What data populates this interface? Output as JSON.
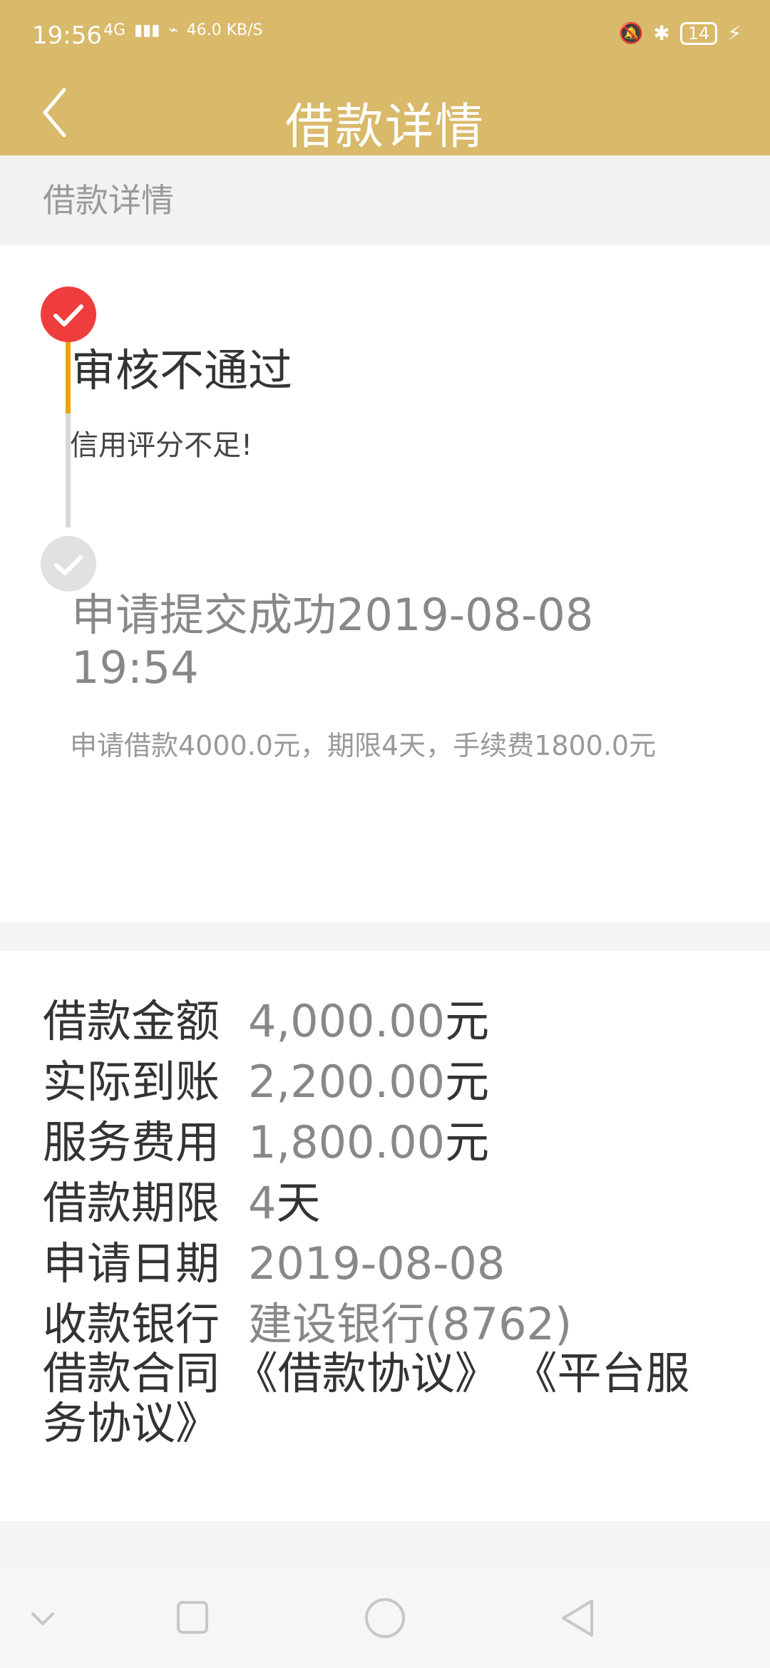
{
  "status_bar": {
    "time": "19:56",
    "network": "4G",
    "speed_top": "46.0",
    "speed_bottom": "KB/S",
    "battery": "14"
  },
  "header": {
    "title": "借款详情"
  },
  "section": {
    "title": "借款详情"
  },
  "timeline": {
    "steps": [
      {
        "title": "审核不通过",
        "description": "信用评分不足!"
      },
      {
        "title": "申请提交成功2019-08-08 19:54",
        "description": "申请借款4000.0元，期限4天，手续费1800.0元"
      }
    ]
  },
  "details": {
    "amount_label": "借款金额",
    "amount_value": "4,000.00",
    "amount_unit": "元",
    "received_label": "实际到账",
    "received_value": "2,200.00",
    "received_unit": "元",
    "fee_label": "服务费用",
    "fee_value": "1,800.00",
    "fee_unit": "元",
    "term_label": "借款期限",
    "term_value": "4",
    "term_unit": "天",
    "date_label": "申请日期",
    "date_value": "2019-08-08",
    "bank_label": "收款银行",
    "bank_value": "建设银行(8762)",
    "contract_label": "借款合同",
    "contract_link_1": "《借款协议》",
    "contract_link_2": "《平台服务协议》"
  },
  "icons": {
    "back": "chevron-left-icon",
    "check": "check-icon",
    "nav_down": "chevron-down-icon",
    "nav_recent": "square-icon",
    "nav_home": "circle-icon",
    "nav_back": "triangle-left-icon"
  },
  "colors": {
    "header": "#d9b96a",
    "reject": "#ef3d3d",
    "progress": "#f0a500"
  }
}
